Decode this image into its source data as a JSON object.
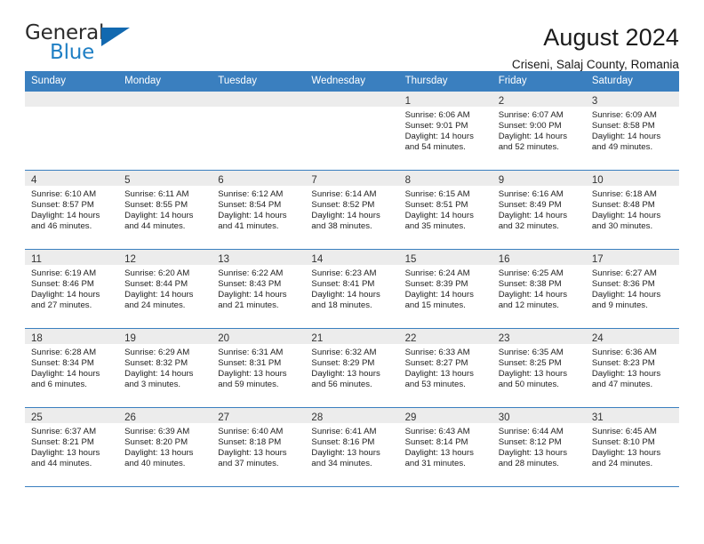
{
  "brand": {
    "name_top": "General",
    "name_bottom": "Blue",
    "accent_color": "#1f7fc4",
    "triangle_color": "#1269b0"
  },
  "header": {
    "title": "August 2024",
    "subtitle": "Criseni, Salaj County, Romania"
  },
  "theme": {
    "header_row_bg": "#3a7fbf",
    "daynum_strip_bg": "#ececec",
    "grid_line": "#3a7fbf",
    "text": "#222222"
  },
  "weekdays": [
    "Sunday",
    "Monday",
    "Tuesday",
    "Wednesday",
    "Thursday",
    "Friday",
    "Saturday"
  ],
  "weeks": [
    [
      {
        "day": "",
        "empty": true
      },
      {
        "day": "",
        "empty": true
      },
      {
        "day": "",
        "empty": true
      },
      {
        "day": "",
        "empty": true
      },
      {
        "day": "1",
        "sunrise": "Sunrise: 6:06 AM",
        "sunset": "Sunset: 9:01 PM",
        "daylight1": "Daylight: 14 hours",
        "daylight2": "and 54 minutes."
      },
      {
        "day": "2",
        "sunrise": "Sunrise: 6:07 AM",
        "sunset": "Sunset: 9:00 PM",
        "daylight1": "Daylight: 14 hours",
        "daylight2": "and 52 minutes."
      },
      {
        "day": "3",
        "sunrise": "Sunrise: 6:09 AM",
        "sunset": "Sunset: 8:58 PM",
        "daylight1": "Daylight: 14 hours",
        "daylight2": "and 49 minutes."
      }
    ],
    [
      {
        "day": "4",
        "sunrise": "Sunrise: 6:10 AM",
        "sunset": "Sunset: 8:57 PM",
        "daylight1": "Daylight: 14 hours",
        "daylight2": "and 46 minutes."
      },
      {
        "day": "5",
        "sunrise": "Sunrise: 6:11 AM",
        "sunset": "Sunset: 8:55 PM",
        "daylight1": "Daylight: 14 hours",
        "daylight2": "and 44 minutes."
      },
      {
        "day": "6",
        "sunrise": "Sunrise: 6:12 AM",
        "sunset": "Sunset: 8:54 PM",
        "daylight1": "Daylight: 14 hours",
        "daylight2": "and 41 minutes."
      },
      {
        "day": "7",
        "sunrise": "Sunrise: 6:14 AM",
        "sunset": "Sunset: 8:52 PM",
        "daylight1": "Daylight: 14 hours",
        "daylight2": "and 38 minutes."
      },
      {
        "day": "8",
        "sunrise": "Sunrise: 6:15 AM",
        "sunset": "Sunset: 8:51 PM",
        "daylight1": "Daylight: 14 hours",
        "daylight2": "and 35 minutes."
      },
      {
        "day": "9",
        "sunrise": "Sunrise: 6:16 AM",
        "sunset": "Sunset: 8:49 PM",
        "daylight1": "Daylight: 14 hours",
        "daylight2": "and 32 minutes."
      },
      {
        "day": "10",
        "sunrise": "Sunrise: 6:18 AM",
        "sunset": "Sunset: 8:48 PM",
        "daylight1": "Daylight: 14 hours",
        "daylight2": "and 30 minutes."
      }
    ],
    [
      {
        "day": "11",
        "sunrise": "Sunrise: 6:19 AM",
        "sunset": "Sunset: 8:46 PM",
        "daylight1": "Daylight: 14 hours",
        "daylight2": "and 27 minutes."
      },
      {
        "day": "12",
        "sunrise": "Sunrise: 6:20 AM",
        "sunset": "Sunset: 8:44 PM",
        "daylight1": "Daylight: 14 hours",
        "daylight2": "and 24 minutes."
      },
      {
        "day": "13",
        "sunrise": "Sunrise: 6:22 AM",
        "sunset": "Sunset: 8:43 PM",
        "daylight1": "Daylight: 14 hours",
        "daylight2": "and 21 minutes."
      },
      {
        "day": "14",
        "sunrise": "Sunrise: 6:23 AM",
        "sunset": "Sunset: 8:41 PM",
        "daylight1": "Daylight: 14 hours",
        "daylight2": "and 18 minutes."
      },
      {
        "day": "15",
        "sunrise": "Sunrise: 6:24 AM",
        "sunset": "Sunset: 8:39 PM",
        "daylight1": "Daylight: 14 hours",
        "daylight2": "and 15 minutes."
      },
      {
        "day": "16",
        "sunrise": "Sunrise: 6:25 AM",
        "sunset": "Sunset: 8:38 PM",
        "daylight1": "Daylight: 14 hours",
        "daylight2": "and 12 minutes."
      },
      {
        "day": "17",
        "sunrise": "Sunrise: 6:27 AM",
        "sunset": "Sunset: 8:36 PM",
        "daylight1": "Daylight: 14 hours",
        "daylight2": "and 9 minutes."
      }
    ],
    [
      {
        "day": "18",
        "sunrise": "Sunrise: 6:28 AM",
        "sunset": "Sunset: 8:34 PM",
        "daylight1": "Daylight: 14 hours",
        "daylight2": "and 6 minutes."
      },
      {
        "day": "19",
        "sunrise": "Sunrise: 6:29 AM",
        "sunset": "Sunset: 8:32 PM",
        "daylight1": "Daylight: 14 hours",
        "daylight2": "and 3 minutes."
      },
      {
        "day": "20",
        "sunrise": "Sunrise: 6:31 AM",
        "sunset": "Sunset: 8:31 PM",
        "daylight1": "Daylight: 13 hours",
        "daylight2": "and 59 minutes."
      },
      {
        "day": "21",
        "sunrise": "Sunrise: 6:32 AM",
        "sunset": "Sunset: 8:29 PM",
        "daylight1": "Daylight: 13 hours",
        "daylight2": "and 56 minutes."
      },
      {
        "day": "22",
        "sunrise": "Sunrise: 6:33 AM",
        "sunset": "Sunset: 8:27 PM",
        "daylight1": "Daylight: 13 hours",
        "daylight2": "and 53 minutes."
      },
      {
        "day": "23",
        "sunrise": "Sunrise: 6:35 AM",
        "sunset": "Sunset: 8:25 PM",
        "daylight1": "Daylight: 13 hours",
        "daylight2": "and 50 minutes."
      },
      {
        "day": "24",
        "sunrise": "Sunrise: 6:36 AM",
        "sunset": "Sunset: 8:23 PM",
        "daylight1": "Daylight: 13 hours",
        "daylight2": "and 47 minutes."
      }
    ],
    [
      {
        "day": "25",
        "sunrise": "Sunrise: 6:37 AM",
        "sunset": "Sunset: 8:21 PM",
        "daylight1": "Daylight: 13 hours",
        "daylight2": "and 44 minutes."
      },
      {
        "day": "26",
        "sunrise": "Sunrise: 6:39 AM",
        "sunset": "Sunset: 8:20 PM",
        "daylight1": "Daylight: 13 hours",
        "daylight2": "and 40 minutes."
      },
      {
        "day": "27",
        "sunrise": "Sunrise: 6:40 AM",
        "sunset": "Sunset: 8:18 PM",
        "daylight1": "Daylight: 13 hours",
        "daylight2": "and 37 minutes."
      },
      {
        "day": "28",
        "sunrise": "Sunrise: 6:41 AM",
        "sunset": "Sunset: 8:16 PM",
        "daylight1": "Daylight: 13 hours",
        "daylight2": "and 34 minutes."
      },
      {
        "day": "29",
        "sunrise": "Sunrise: 6:43 AM",
        "sunset": "Sunset: 8:14 PM",
        "daylight1": "Daylight: 13 hours",
        "daylight2": "and 31 minutes."
      },
      {
        "day": "30",
        "sunrise": "Sunrise: 6:44 AM",
        "sunset": "Sunset: 8:12 PM",
        "daylight1": "Daylight: 13 hours",
        "daylight2": "and 28 minutes."
      },
      {
        "day": "31",
        "sunrise": "Sunrise: 6:45 AM",
        "sunset": "Sunset: 8:10 PM",
        "daylight1": "Daylight: 13 hours",
        "daylight2": "and 24 minutes."
      }
    ]
  ]
}
